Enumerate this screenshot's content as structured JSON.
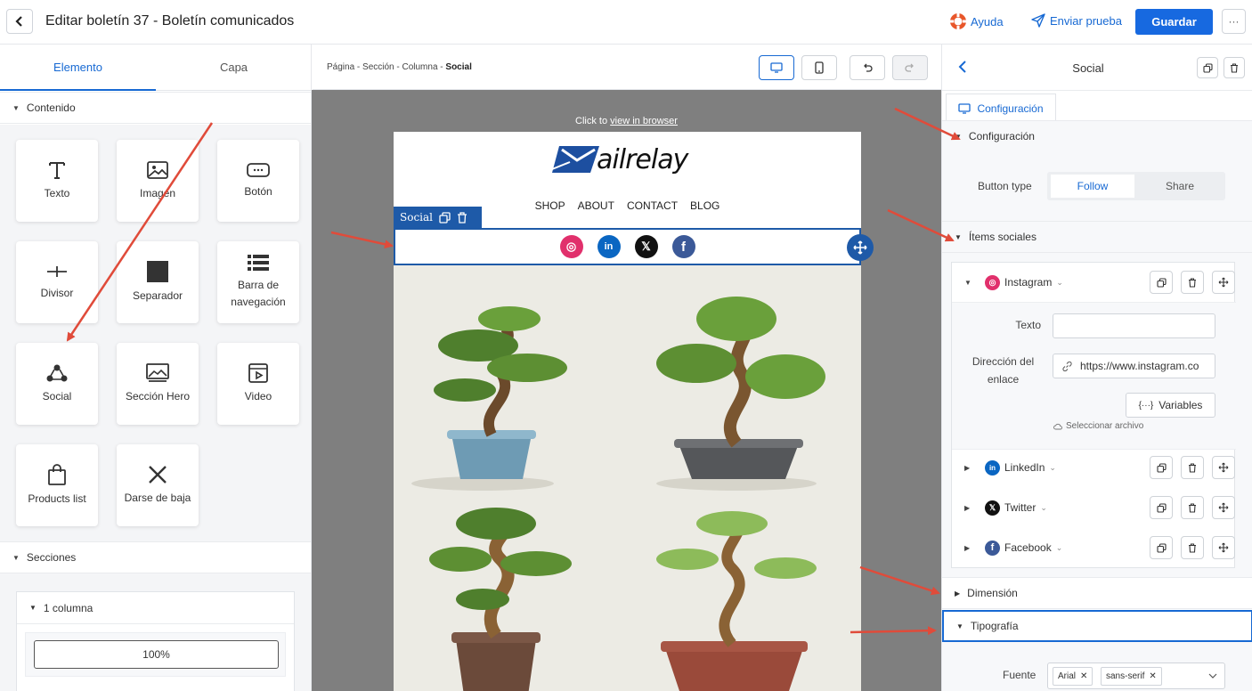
{
  "header": {
    "title": "Editar boletín 37 - Boletín comunicados",
    "help_label": "Ayuda",
    "send_test_label": "Enviar prueba",
    "save_label": "Guardar",
    "more_label": "···"
  },
  "left_panel": {
    "tabs": [
      {
        "label": "Elemento",
        "active": true
      },
      {
        "label": "Capa",
        "active": false
      }
    ],
    "content_section": "Contenido",
    "tiles": [
      {
        "label": "Texto",
        "icon": "text-icon"
      },
      {
        "label": "Imagen",
        "icon": "image-icon"
      },
      {
        "label": "Botón",
        "icon": "button-icon"
      },
      {
        "label": "Divisor",
        "icon": "divider-icon"
      },
      {
        "label": "Separador",
        "icon": "spacer-icon"
      },
      {
        "label": "Barra de navegación",
        "icon": "navbar-icon"
      },
      {
        "label": "Social",
        "icon": "social-icon"
      },
      {
        "label": "Sección Hero",
        "icon": "hero-icon"
      },
      {
        "label": "Video",
        "icon": "video-icon"
      },
      {
        "label": "Products list",
        "icon": "bag-icon"
      },
      {
        "label": "Darse de baja",
        "icon": "close-icon"
      }
    ],
    "sections_section": "Secciones",
    "column_group": "1 columna",
    "column_option": "100%"
  },
  "center": {
    "breadcrumb": {
      "path": "Página - Sección - Columna - ",
      "current": "Social"
    },
    "view_in_browser_prefix": "Click to ",
    "view_in_browser_link": "view in browser",
    "brand": {
      "lead": "ail",
      "rest": "relay"
    },
    "nav_items": [
      "SHOP",
      "ABOUT",
      "CONTACT",
      "BLOG"
    ],
    "social_tag": "Social",
    "social_icons": [
      {
        "name": "instagram",
        "color": "#e1306c",
        "glyph": "◎"
      },
      {
        "name": "linkedin",
        "color": "#0a66c2",
        "glyph": "in"
      },
      {
        "name": "twitter",
        "color": "#111111",
        "glyph": "𝕏"
      },
      {
        "name": "facebook",
        "color": "#3b5998",
        "glyph": "f"
      }
    ]
  },
  "right_panel": {
    "title": "Social",
    "config_tab": "Configuración",
    "config_section": "Configuración",
    "button_type_label": "Button type",
    "button_type_options": [
      "Follow",
      "Share"
    ],
    "button_type_selected": "Follow",
    "social_items_section": "Ítems sociales",
    "items": [
      {
        "label": "Instagram",
        "color": "#e1306c",
        "glyph": "◎",
        "expanded": true
      },
      {
        "label": "LinkedIn",
        "color": "#0a66c2",
        "glyph": "in",
        "expanded": false
      },
      {
        "label": "Twitter",
        "color": "#111111",
        "glyph": "𝕏",
        "expanded": false
      },
      {
        "label": "Facebook",
        "color": "#3b5998",
        "glyph": "f",
        "expanded": false
      }
    ],
    "text_label": "Texto",
    "text_value": "",
    "link_label": "Dirección del enlace",
    "link_value": "https://www.instagram.co",
    "variables_label": "Variables",
    "select_file_label": "Seleccionar archivo",
    "dimension_section": "Dimensión",
    "typography_section": "Tipografía",
    "font_label": "Fuente",
    "font_chips": [
      "Arial",
      "sans-serif"
    ]
  },
  "colors": {
    "accent": "#1769d3",
    "primary_button": "#1769e0",
    "selection": "#1e5aa8",
    "annotation_arrow": "#e04b3a"
  }
}
